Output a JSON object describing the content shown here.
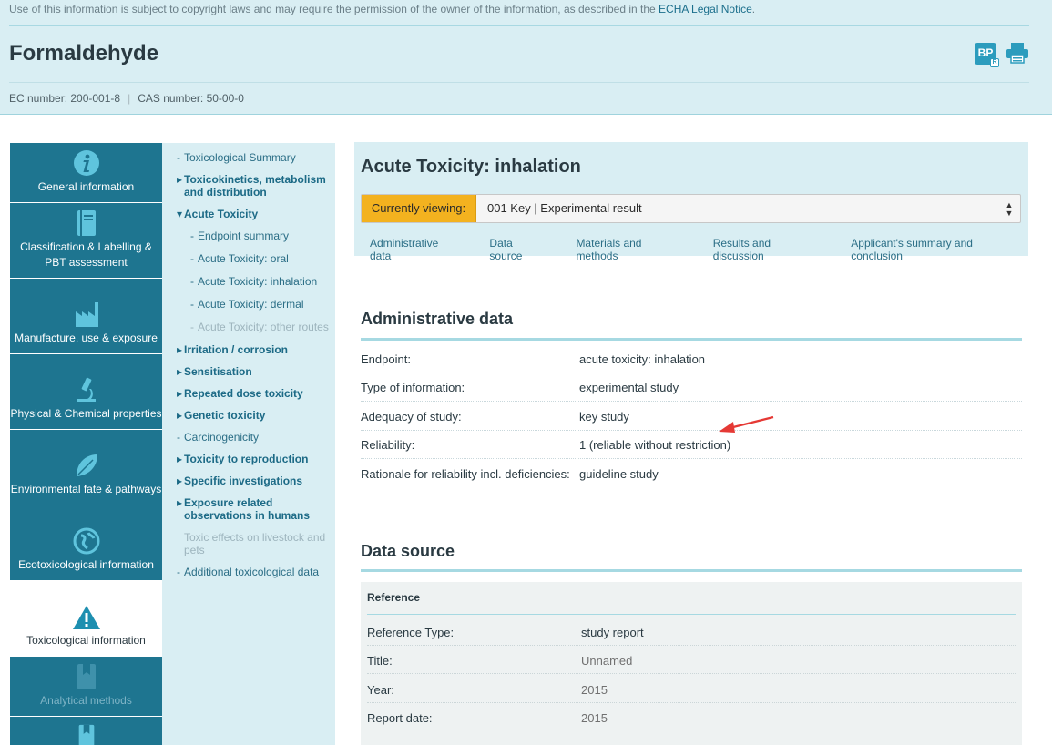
{
  "header": {
    "notice_text": "Use of this information is subject to copyright laws and may require the permission of the owner of the information, as described in the ",
    "notice_link": "ECHA Legal Notice",
    "notice_end": ".",
    "title": "Formaldehyde",
    "bp_label": "BP",
    "bp_sub": "R",
    "ec_label": "EC number: 200-001-8",
    "sep": "|",
    "cas_label": "CAS number: 50-00-0"
  },
  "left_nav": [
    {
      "label": "General information",
      "icon": "info-icon"
    },
    {
      "label": "Classification & Labelling & PBT assessment",
      "icon": "book-icon"
    },
    {
      "label": "Manufacture, use & exposure",
      "icon": "factory-icon"
    },
    {
      "label": "Physical & Chemical properties",
      "icon": "microscope-icon"
    },
    {
      "label": "Environmental fate & pathways",
      "icon": "leaf-icon"
    },
    {
      "label": "Ecotoxicological information",
      "icon": "eco-globe-icon"
    },
    {
      "label": "Toxicological information",
      "icon": "warning-icon",
      "active": true
    },
    {
      "label": "Analytical methods",
      "icon": "bookmark-icon",
      "disabled": true
    },
    {
      "label": "",
      "icon": "bookmark-icon"
    }
  ],
  "sub_nav": {
    "toxicological_summary": "Toxicological Summary",
    "toxicokinetics": "Toxicokinetics, metabolism and distribution",
    "acute_toxicity": "Acute Toxicity",
    "endpoint_summary": "Endpoint summary",
    "acute_oral": "Acute Toxicity: oral",
    "acute_inhalation": "Acute Toxicity: inhalation",
    "acute_dermal": "Acute Toxicity: dermal",
    "acute_other": "Acute Toxicity: other routes",
    "irritation": "Irritation / corrosion",
    "sensitisation": "Sensitisation",
    "repeated_dose": "Repeated dose toxicity",
    "genetic": "Genetic toxicity",
    "carcinogenicity": "Carcinogenicity",
    "reproduction": "Toxicity to reproduction",
    "specific": "Specific investigations",
    "exposure_related": "Exposure related observations in humans",
    "livestock": "Toxic effects on livestock and pets",
    "additional": "Additional toxicological data"
  },
  "content": {
    "section_title": "Acute Toxicity: inhalation",
    "currently_viewing_label": "Currently viewing:",
    "currently_viewing_value": "001 Key | Experimental result",
    "tabs": [
      "Administrative data",
      "Data source",
      "Materials and methods",
      "Results and discussion",
      "Applicant's summary and conclusion"
    ]
  },
  "administrative": {
    "heading": "Administrative data",
    "rows": [
      {
        "k": "Endpoint:",
        "v": "acute toxicity: inhalation"
      },
      {
        "k": "Type of information:",
        "v": "experimental study"
      },
      {
        "k": "Adequacy of study:",
        "v": "key study"
      },
      {
        "k": "Reliability:",
        "v": "1 (reliable without restriction)"
      },
      {
        "k": "Rationale for reliability incl. deficiencies:",
        "v": "guideline study"
      }
    ]
  },
  "data_source": {
    "heading": "Data source",
    "reference_title": "Reference",
    "rows": [
      {
        "k": "Reference Type:",
        "v": "study report"
      },
      {
        "k": "Title:",
        "v": "Unnamed"
      },
      {
        "k": "Year:",
        "v": "2015"
      },
      {
        "k": "Report date:",
        "v": "2015"
      }
    ]
  },
  "colors": {
    "header_bg": "#d9eef3",
    "nav_tile": "#1e7590",
    "accent_orange": "#f3b21f",
    "link": "#1c6a86",
    "annotation_red": "#e53935"
  }
}
